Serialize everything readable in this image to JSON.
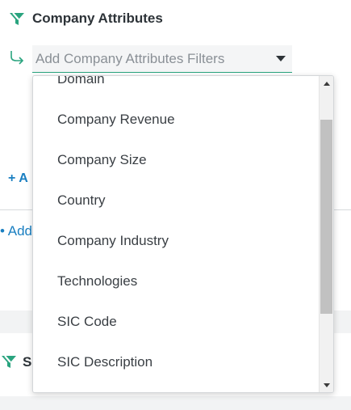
{
  "section": {
    "title": "Company Attributes",
    "icon": "funnel-icon",
    "accent_color": "#2aa47f"
  },
  "filter_select": {
    "placeholder": "Add Company Attributes Filters",
    "caret_icon": "caret-down-icon"
  },
  "background": {
    "add_small_label": "+ A",
    "add_large_label": "• Add",
    "next_section_initial": "S"
  },
  "dropdown": {
    "options": [
      "Domain",
      "Company Revenue",
      "Company Size",
      "Country",
      "Company Industry",
      "Technologies",
      "SIC Code",
      "SIC Description"
    ]
  }
}
